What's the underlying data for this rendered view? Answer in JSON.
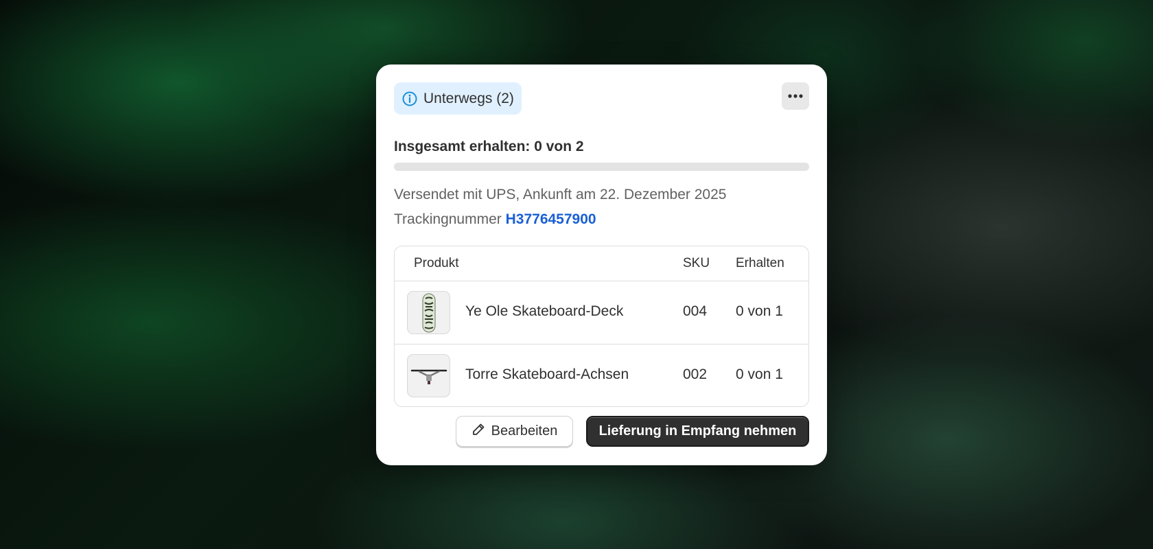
{
  "status_badge": {
    "label": "Unterwegs (2)",
    "icon": "info-icon",
    "color": "#1a8fd6"
  },
  "more_menu": {
    "icon": "more-horizontal-icon"
  },
  "summary": {
    "total_label": "Insgesamt erhalten: 0 von 2",
    "received": 0,
    "total": 2,
    "progress_fraction": 0
  },
  "shipment": {
    "carrier_line": "Versendet mit UPS, Ankunft am 22. Dezember 2025",
    "tracking_label": "Trackingnummer",
    "tracking_number": "H3776457900"
  },
  "table": {
    "columns": [
      "Produkt",
      "SKU",
      "Erhalten"
    ],
    "rows": [
      {
        "product": "Ye Ole Skateboard-Deck",
        "sku": "004",
        "received": "0 von 1",
        "thumb_icon": "skateboard-deck-icon"
      },
      {
        "product": "Torre Skateboard-Achsen",
        "sku": "002",
        "received": "0 von 1",
        "thumb_icon": "skateboard-truck-icon"
      }
    ]
  },
  "actions": {
    "edit_label": "Bearbeiten",
    "edit_icon": "pencil-icon",
    "primary_label": "Lieferung in Empfang nehmen"
  },
  "colors": {
    "badge_bg": "#e0f0ff",
    "link": "#1a5fd6",
    "primary_button": "#303030"
  }
}
